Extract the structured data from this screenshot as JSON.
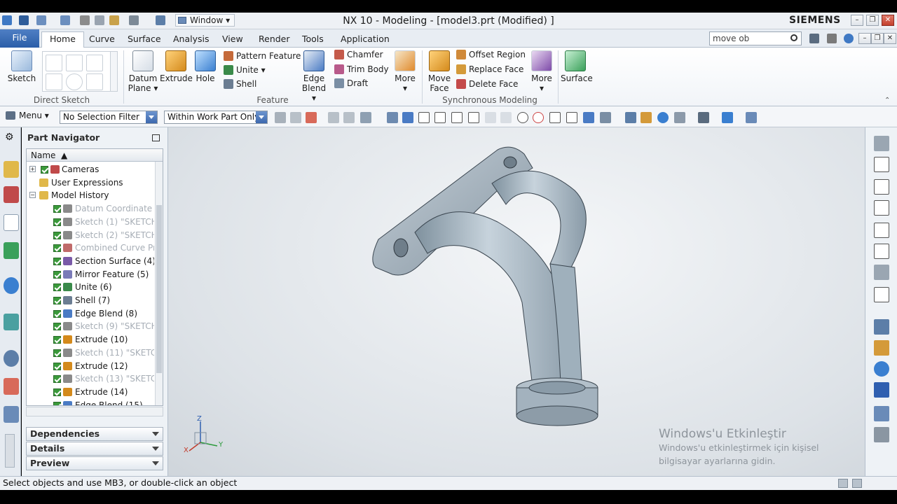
{
  "window": {
    "title": "NX 10 - Modeling - [model3.prt (Modified) ]",
    "brand": "SIEMENS",
    "window_menu": "Window"
  },
  "tabs": {
    "file": "File",
    "items": [
      "Home",
      "Curve",
      "Surface",
      "Analysis",
      "View",
      "Render",
      "Tools",
      "Application"
    ],
    "active": "Home"
  },
  "search": {
    "value": "move ob"
  },
  "ribbon": {
    "direct_sketch": {
      "label": "Direct Sketch",
      "sketch": "Sketch"
    },
    "feature": {
      "label": "Feature",
      "datum_plane": [
        "Datum",
        "Plane"
      ],
      "extrude": "Extrude",
      "hole": "Hole",
      "pattern_feature": "Pattern Feature",
      "unite": "Unite",
      "shell": "Shell",
      "edge_blend": [
        "Edge",
        "Blend"
      ],
      "chamfer": "Chamfer",
      "trim_body": "Trim Body",
      "draft": "Draft",
      "more": "More"
    },
    "synchronous": {
      "label": "Synchronous Modeling",
      "move_face": [
        "Move",
        "Face"
      ],
      "offset_region": "Offset Region",
      "replace_face": "Replace Face",
      "delete_face": "Delete Face",
      "more": "More"
    },
    "surface": "Surface"
  },
  "cmdbar": {
    "menu": "Menu",
    "selection_filter": "No Selection Filter",
    "scope": "Within Work Part Only"
  },
  "navigator": {
    "title": "Part Navigator",
    "column": "Name",
    "rows": [
      {
        "label": "Cameras",
        "type": "root"
      },
      {
        "label": "User Expressions",
        "type": "folder"
      },
      {
        "label": "Model History",
        "type": "root"
      },
      {
        "label": "Datum Coordinate ...",
        "type": "item",
        "dim": true
      },
      {
        "label": "Sketch (1) \"SKETCH...",
        "type": "item",
        "dim": true
      },
      {
        "label": "Sketch (2) \"SKETCH...",
        "type": "item",
        "dim": true
      },
      {
        "label": "Combined Curve Pr...",
        "type": "item",
        "dim": true
      },
      {
        "label": "Section Surface (4)",
        "type": "item",
        "dim": false
      },
      {
        "label": "Mirror Feature (5)",
        "type": "item",
        "dim": false
      },
      {
        "label": "Unite (6)",
        "type": "item",
        "dim": false
      },
      {
        "label": "Shell (7)",
        "type": "item",
        "dim": false
      },
      {
        "label": "Edge Blend (8)",
        "type": "item",
        "dim": false
      },
      {
        "label": "Sketch (9) \"SKETCH...",
        "type": "item",
        "dim": true
      },
      {
        "label": "Extrude (10)",
        "type": "item",
        "dim": false
      },
      {
        "label": "Sketch (11) \"SKETC...",
        "type": "item",
        "dim": true
      },
      {
        "label": "Extrude (12)",
        "type": "item",
        "dim": false
      },
      {
        "label": "Sketch (13) \"SKETC...",
        "type": "item",
        "dim": true
      },
      {
        "label": "Extrude (14)",
        "type": "item",
        "dim": false
      },
      {
        "label": "Edge Blend (15)",
        "type": "item",
        "dim": false
      }
    ],
    "panels": [
      "Dependencies",
      "Details",
      "Preview"
    ]
  },
  "watermark": {
    "title": "Windows'u Etkinleştir",
    "subtitle": "Windows'u etkinleştirmek için kişisel bilgisayar ayarlarına gidin."
  },
  "triad": {
    "x": "X",
    "y": "Y",
    "z": "Z"
  },
  "status": "Select objects and use MB3, or double-click an object",
  "colors": {
    "accent": "#2b5ea8",
    "model": "#a9b8c3",
    "check": "#3b9a3b"
  }
}
